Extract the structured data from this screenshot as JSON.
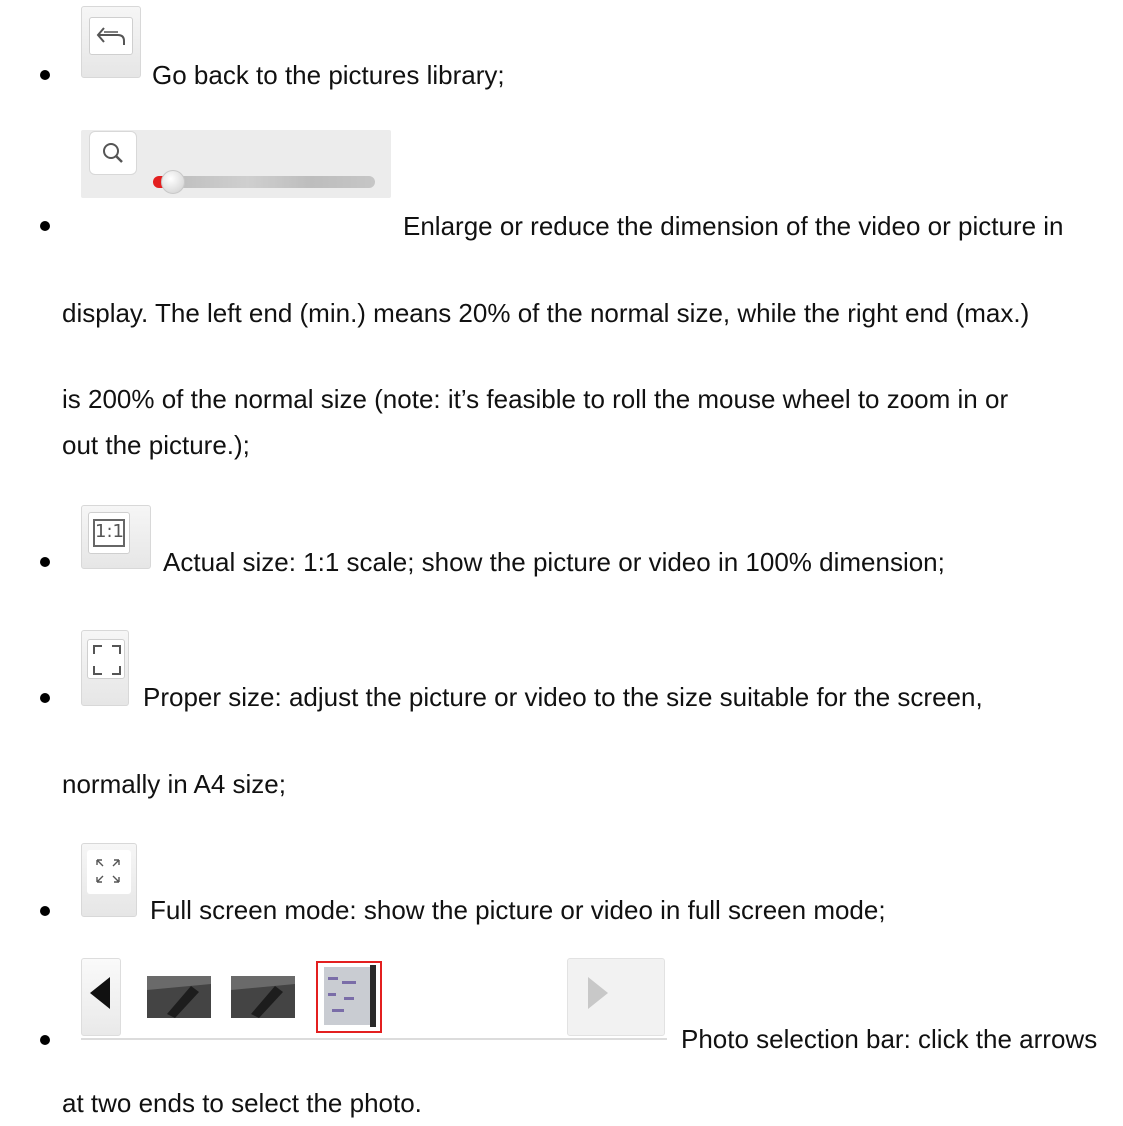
{
  "items": [
    {
      "icon": "go-back-icon",
      "lines": [
        "Go back to the pictures library;"
      ]
    },
    {
      "icon": "zoom-slider-icon",
      "lines": [
        "Enlarge or reduce the dimension of the video or picture in",
        "display. The left end (min.) means 20% of the normal size, while the right end (max.)",
        "is 200% of the normal size (note: it’s feasible to roll the mouse wheel to zoom in or",
        "out the picture.);"
      ],
      "zoom_level_fraction": 0.0
    },
    {
      "icon": "actual-size-icon",
      "icon_text": "1:1",
      "lines": [
        "Actual size: 1:1 scale; show the picture or video in 100% dimension;"
      ]
    },
    {
      "icon": "proper-size-icon",
      "lines": [
        "Proper size: adjust the picture or video to the size suitable for the screen,",
        "normally in A4 size;"
      ]
    },
    {
      "icon": "full-screen-icon",
      "lines": [
        "Full screen mode: show the picture or video in full screen mode;"
      ]
    },
    {
      "icon": "photo-selection-bar-icon",
      "lines": [
        "Photo selection bar: click the arrows",
        "at two ends to select the photo."
      ],
      "selected_thumbnail": 3,
      "thumbnail_count": 3
    }
  ],
  "colors": {
    "accent_red": "#e31f1f",
    "icon_gray": "#5a5a5a"
  }
}
